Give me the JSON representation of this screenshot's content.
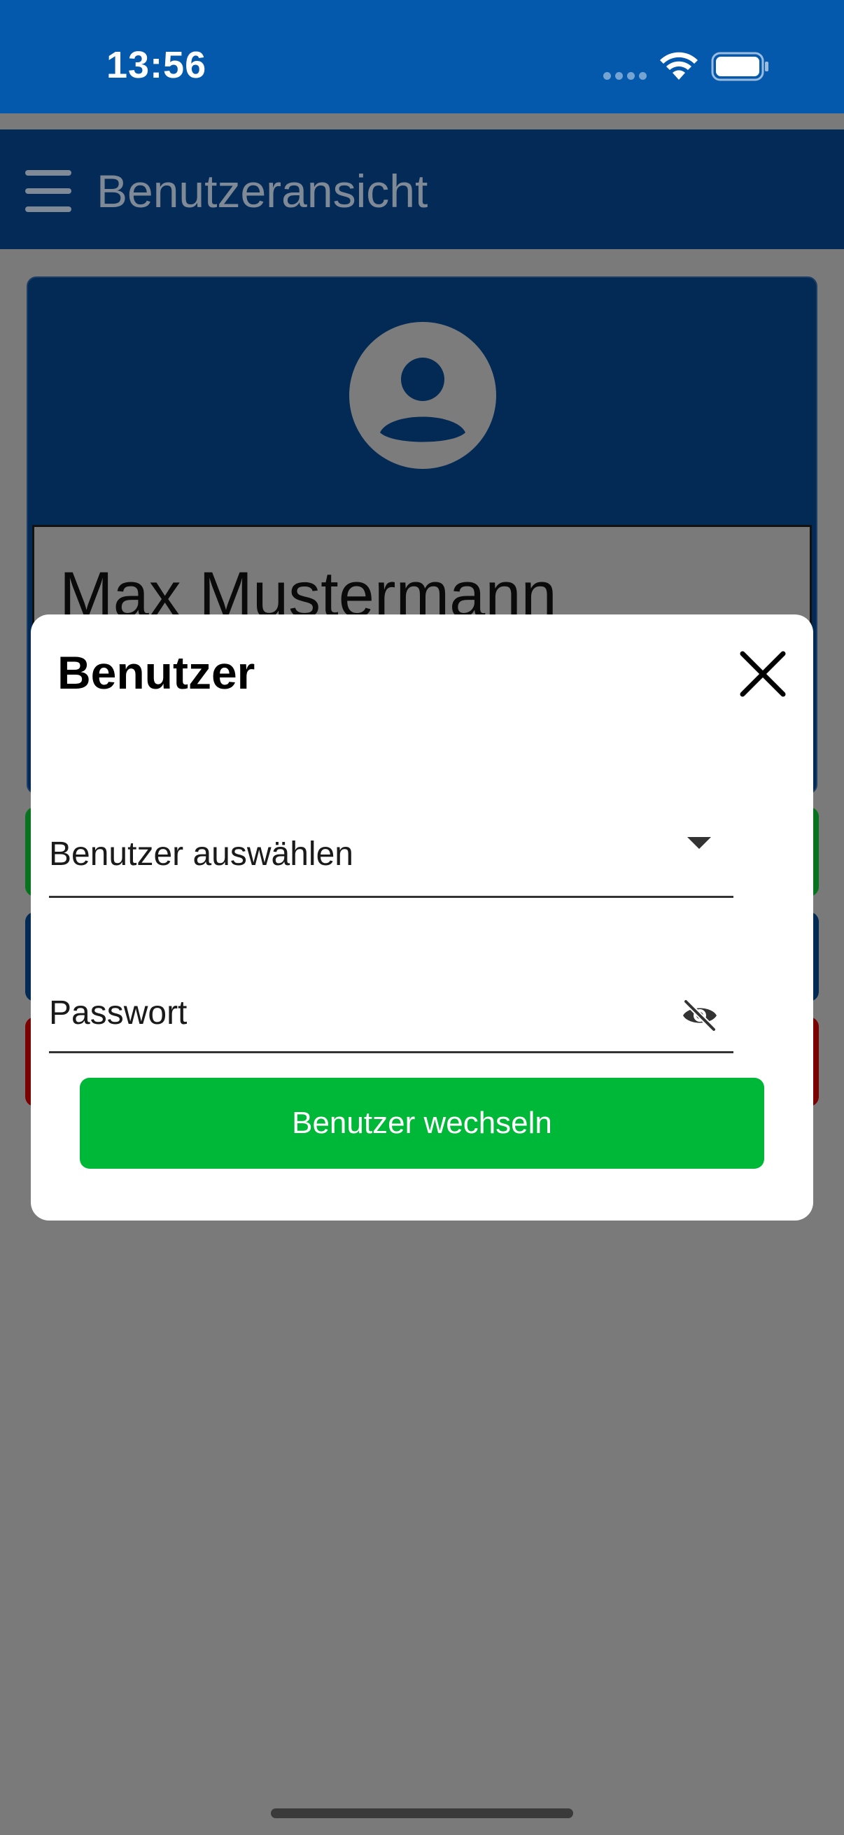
{
  "status_bar": {
    "time": "13:56"
  },
  "app": {
    "title": "Benutzeransicht",
    "profile": {
      "name": "Max Mustermann"
    }
  },
  "dialog": {
    "title": "Benutzer",
    "user_select": {
      "value": "Benutzer auswählen"
    },
    "password": {
      "placeholder": "Passwort"
    },
    "submit_label": "Benutzer wechseln"
  },
  "colors": {
    "status_bar": "#0459ad",
    "header": "#042a57",
    "submit_button": "#00b837",
    "overlay": "#7a7a7a"
  },
  "icons": [
    "wifi-icon",
    "battery-icon",
    "menu-icon",
    "avatar-icon",
    "close-icon",
    "dropdown-arrow-icon",
    "eye-off-icon"
  ]
}
